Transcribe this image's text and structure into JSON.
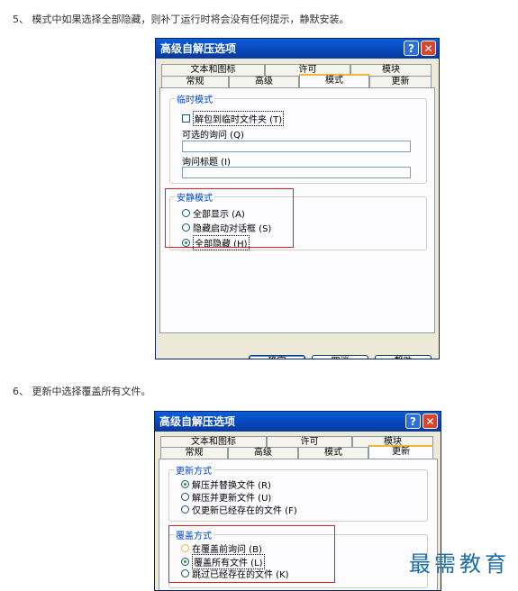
{
  "step5": {
    "text": "5、 模式中如果选择全部隐藏，则补丁运行时将会没有任何提示，静默安装。"
  },
  "step6": {
    "text": "6、 更新中选择覆盖所有文件。"
  },
  "dialog": {
    "title": "高级自解压选项",
    "help_glyph": "?",
    "close_glyph": "✕",
    "tabs_back": [
      "文本和图标",
      "许可",
      "模块"
    ],
    "tabs_front": [
      "常规",
      "高级",
      "模式",
      "更新"
    ]
  },
  "mode_tab": {
    "temp_group": "临时模式",
    "unpack_temp": "解包到临时文件夹 (T)",
    "optional_prompt_label": "可选的询问 (Q)",
    "optional_prompt_value": "",
    "prompt_title_label": "询问标题 (I)",
    "prompt_title_value": "",
    "silent_group": "安静模式",
    "silent_options": [
      "全部显示 (A)",
      "隐藏启动对话框 (S)",
      "全部隐藏 (H)"
    ],
    "silent_selected": "全部隐藏 (H)",
    "buttons": {
      "ok": "确定",
      "cancel": "取消",
      "help": "帮助"
    }
  },
  "update_tab": {
    "update_group": "更新方式",
    "update_options": [
      "解压并替换文件 (R)",
      "解压并更新文件 (U)",
      "仅更新已经存在的文件 (F)"
    ],
    "update_selected": "解压并替换文件 (R)",
    "overwrite_group": "覆盖方式",
    "overwrite_options": [
      "在覆盖前询问 (B)",
      "覆盖所有文件 (L)",
      "跳过已经存在的文件 (K)"
    ],
    "overwrite_selected": "覆盖所有文件 (L)"
  },
  "watermark": "最需教育",
  "colors": {
    "title_bar": "#0845b8",
    "dialog_bg": "#ece9d8",
    "highlight_box": "#d2232a",
    "group_label": "#0046d5"
  }
}
